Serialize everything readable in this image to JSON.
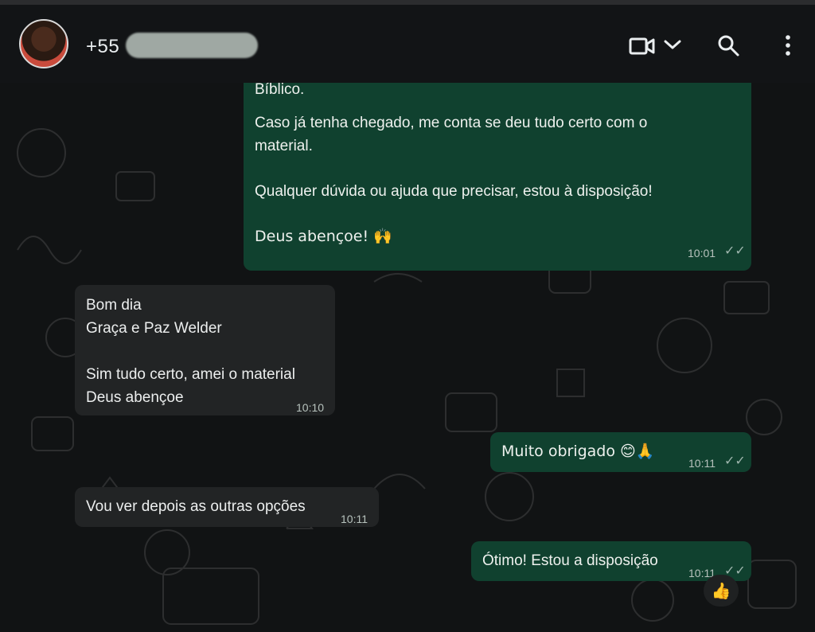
{
  "header": {
    "contact_name": "+55",
    "video_icon": "video-camera-icon",
    "dropdown_icon": "chevron-down-icon",
    "search_icon": "search-icon",
    "menu_icon": "vertical-dots-icon"
  },
  "messages": {
    "m1": {
      "line1": "Bíblico.",
      "line2": "Caso já tenha chegado, me conta se deu tudo certo com o",
      "line3": "material.",
      "line4": "Qualquer dúvida ou ajuda que precisar, estou à disposição!",
      "line5": "Deus abençoe! 🙌",
      "time": "10:01"
    },
    "m2": {
      "line1": "Bom dia",
      "line2": "Graça e Paz Welder",
      "line3": "Sim tudo certo, amei o material",
      "line4": "Deus abençoe",
      "time": "10:10"
    },
    "m3": {
      "text": "Muito obrigado 😊🙏",
      "time": "10:11"
    },
    "m4": {
      "text": "Vou ver depois as outras opções",
      "time": "10:11"
    },
    "m5": {
      "text": "Ótimo! Estou a disposição",
      "time": "10:11",
      "reaction": "👍"
    }
  },
  "colors": {
    "outgoing_bubble": "#10412f",
    "incoming_bubble": "#222425",
    "background": "#111314"
  }
}
